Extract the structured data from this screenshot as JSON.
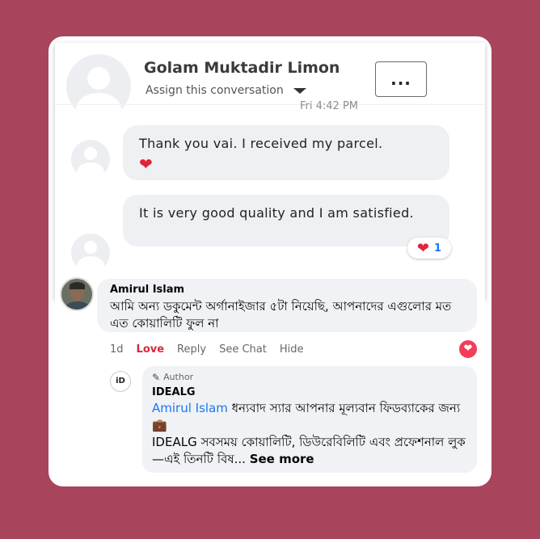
{
  "messenger": {
    "contact_name": "Golam Muktadir Limon",
    "assign_label": "Assign this conversation",
    "more_label": "...",
    "timestamp": "Fri 4:42 PM",
    "messages": [
      {
        "text": "Thank you vai. I received my parcel.",
        "emoji": "❤"
      },
      {
        "text": "It is very good quality and I am satisfied."
      }
    ],
    "reaction": {
      "icon": "heart-icon",
      "count": "1"
    }
  },
  "comment": {
    "author": "Amirul Islam",
    "text": "আমি অন্য ডকুমেন্ট অর্গানাইজার ৫টা নিয়েছি, আপনাদের এগুলোর মত এত কোয়ালিটি ফুল না",
    "actions": {
      "time": "1d",
      "love": "Love",
      "reply": "Reply",
      "see_chat": "See Chat",
      "hide": "Hide"
    },
    "reaction_icon": "love-reaction-icon"
  },
  "reply": {
    "page_avatar_text": "iD",
    "author_tag": "Author",
    "page_name": "IDEALG",
    "mention": "Amirul Islam",
    "text_1": " ধন্যবাদ স্যার আপনার মূল্যবান ফিডব্যাকের জন্য ",
    "emoji": "💼",
    "text_2": "IDEALG সবসময় কোয়ালিটি, ডিউরেবিলিটি এবং প্রফেশনাল লুক—এই তিনটি বিষ... ",
    "see_more": "See more"
  },
  "colors": {
    "background": "#a8455c",
    "heart": "#e0243b",
    "link": "#1877f2"
  }
}
